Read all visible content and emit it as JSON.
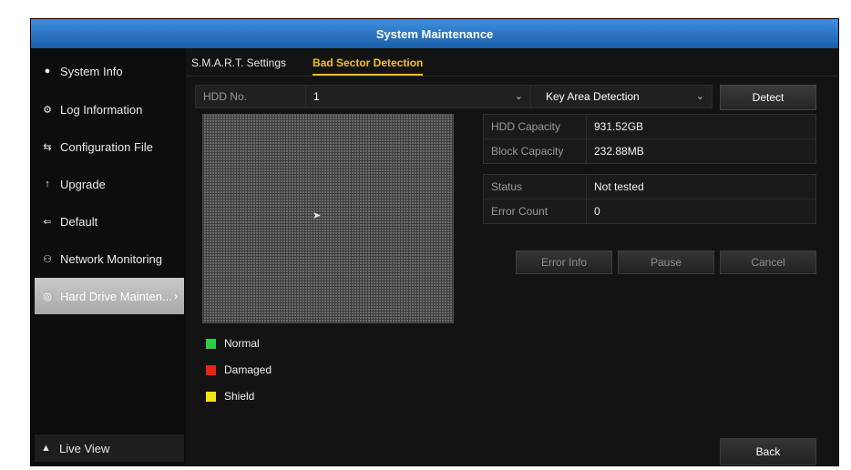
{
  "window": {
    "title": "System Maintenance"
  },
  "sidebar": {
    "items": [
      {
        "label": "System Info",
        "icon": "info-icon"
      },
      {
        "label": "Log Information",
        "icon": "log-icon"
      },
      {
        "label": "Configuration File",
        "icon": "config-file-icon"
      },
      {
        "label": "Upgrade",
        "icon": "upgrade-icon"
      },
      {
        "label": "Default",
        "icon": "default-icon"
      },
      {
        "label": "Network Monitoring",
        "icon": "network-icon"
      },
      {
        "label": "Hard Drive Mainten...",
        "icon": "hard-drive-icon",
        "active": true
      }
    ],
    "live_view": "Live View"
  },
  "tabs": [
    {
      "label": "S.M.A.R.T. Settings",
      "active": false
    },
    {
      "label": "Bad Sector Detection",
      "active": true
    }
  ],
  "detection": {
    "hdd_label": "HDD No.",
    "hdd_value": "1",
    "mode_value": "Key Area Detection",
    "detect_button": "Detect"
  },
  "capacity": {
    "hdd_capacity_label": "HDD Capacity",
    "hdd_capacity_value": "931.52GB",
    "block_capacity_label": "Block Capacity",
    "block_capacity_value": "232.88MB"
  },
  "status": {
    "status_label": "Status",
    "status_value": "Not tested",
    "error_count_label": "Error Count",
    "error_count_value": "0"
  },
  "actions": {
    "error_info": "Error Info",
    "pause": "Pause",
    "cancel": "Cancel"
  },
  "legend": [
    {
      "label": "Normal",
      "color": "#2ecc40"
    },
    {
      "label": "Damaged",
      "color": "#e8231a"
    },
    {
      "label": "Shield",
      "color": "#f5e313"
    }
  ],
  "footer": {
    "back": "Back"
  },
  "colors": {
    "title_bar": "#2f7fd0",
    "active_tab": "#f0c020",
    "active_nav": "#b8b8b8"
  }
}
